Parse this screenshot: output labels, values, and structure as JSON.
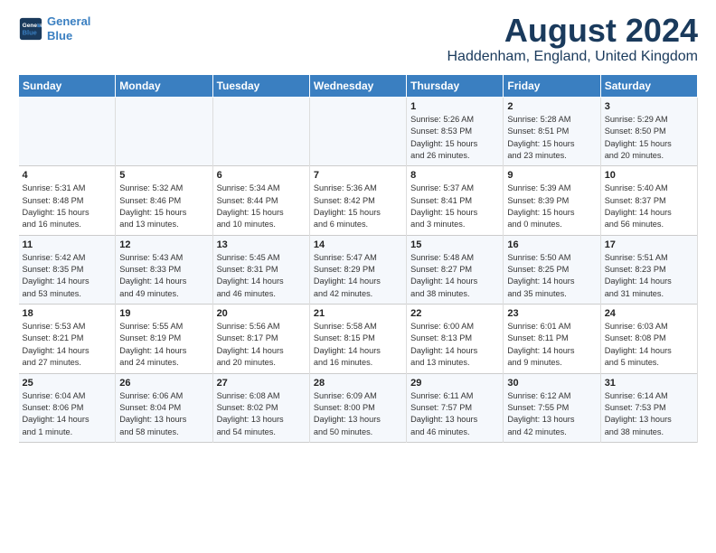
{
  "header": {
    "logo_line1": "General",
    "logo_line2": "Blue",
    "month_title": "August 2024",
    "location": "Haddenham, England, United Kingdom"
  },
  "weekdays": [
    "Sunday",
    "Monday",
    "Tuesday",
    "Wednesday",
    "Thursday",
    "Friday",
    "Saturday"
  ],
  "weeks": [
    [
      {
        "day": "",
        "info": ""
      },
      {
        "day": "",
        "info": ""
      },
      {
        "day": "",
        "info": ""
      },
      {
        "day": "",
        "info": ""
      },
      {
        "day": "1",
        "info": "Sunrise: 5:26 AM\nSunset: 8:53 PM\nDaylight: 15 hours\nand 26 minutes."
      },
      {
        "day": "2",
        "info": "Sunrise: 5:28 AM\nSunset: 8:51 PM\nDaylight: 15 hours\nand 23 minutes."
      },
      {
        "day": "3",
        "info": "Sunrise: 5:29 AM\nSunset: 8:50 PM\nDaylight: 15 hours\nand 20 minutes."
      }
    ],
    [
      {
        "day": "4",
        "info": "Sunrise: 5:31 AM\nSunset: 8:48 PM\nDaylight: 15 hours\nand 16 minutes."
      },
      {
        "day": "5",
        "info": "Sunrise: 5:32 AM\nSunset: 8:46 PM\nDaylight: 15 hours\nand 13 minutes."
      },
      {
        "day": "6",
        "info": "Sunrise: 5:34 AM\nSunset: 8:44 PM\nDaylight: 15 hours\nand 10 minutes."
      },
      {
        "day": "7",
        "info": "Sunrise: 5:36 AM\nSunset: 8:42 PM\nDaylight: 15 hours\nand 6 minutes."
      },
      {
        "day": "8",
        "info": "Sunrise: 5:37 AM\nSunset: 8:41 PM\nDaylight: 15 hours\nand 3 minutes."
      },
      {
        "day": "9",
        "info": "Sunrise: 5:39 AM\nSunset: 8:39 PM\nDaylight: 15 hours\nand 0 minutes."
      },
      {
        "day": "10",
        "info": "Sunrise: 5:40 AM\nSunset: 8:37 PM\nDaylight: 14 hours\nand 56 minutes."
      }
    ],
    [
      {
        "day": "11",
        "info": "Sunrise: 5:42 AM\nSunset: 8:35 PM\nDaylight: 14 hours\nand 53 minutes."
      },
      {
        "day": "12",
        "info": "Sunrise: 5:43 AM\nSunset: 8:33 PM\nDaylight: 14 hours\nand 49 minutes."
      },
      {
        "day": "13",
        "info": "Sunrise: 5:45 AM\nSunset: 8:31 PM\nDaylight: 14 hours\nand 46 minutes."
      },
      {
        "day": "14",
        "info": "Sunrise: 5:47 AM\nSunset: 8:29 PM\nDaylight: 14 hours\nand 42 minutes."
      },
      {
        "day": "15",
        "info": "Sunrise: 5:48 AM\nSunset: 8:27 PM\nDaylight: 14 hours\nand 38 minutes."
      },
      {
        "day": "16",
        "info": "Sunrise: 5:50 AM\nSunset: 8:25 PM\nDaylight: 14 hours\nand 35 minutes."
      },
      {
        "day": "17",
        "info": "Sunrise: 5:51 AM\nSunset: 8:23 PM\nDaylight: 14 hours\nand 31 minutes."
      }
    ],
    [
      {
        "day": "18",
        "info": "Sunrise: 5:53 AM\nSunset: 8:21 PM\nDaylight: 14 hours\nand 27 minutes."
      },
      {
        "day": "19",
        "info": "Sunrise: 5:55 AM\nSunset: 8:19 PM\nDaylight: 14 hours\nand 24 minutes."
      },
      {
        "day": "20",
        "info": "Sunrise: 5:56 AM\nSunset: 8:17 PM\nDaylight: 14 hours\nand 20 minutes."
      },
      {
        "day": "21",
        "info": "Sunrise: 5:58 AM\nSunset: 8:15 PM\nDaylight: 14 hours\nand 16 minutes."
      },
      {
        "day": "22",
        "info": "Sunrise: 6:00 AM\nSunset: 8:13 PM\nDaylight: 14 hours\nand 13 minutes."
      },
      {
        "day": "23",
        "info": "Sunrise: 6:01 AM\nSunset: 8:11 PM\nDaylight: 14 hours\nand 9 minutes."
      },
      {
        "day": "24",
        "info": "Sunrise: 6:03 AM\nSunset: 8:08 PM\nDaylight: 14 hours\nand 5 minutes."
      }
    ],
    [
      {
        "day": "25",
        "info": "Sunrise: 6:04 AM\nSunset: 8:06 PM\nDaylight: 14 hours\nand 1 minute."
      },
      {
        "day": "26",
        "info": "Sunrise: 6:06 AM\nSunset: 8:04 PM\nDaylight: 13 hours\nand 58 minutes."
      },
      {
        "day": "27",
        "info": "Sunrise: 6:08 AM\nSunset: 8:02 PM\nDaylight: 13 hours\nand 54 minutes."
      },
      {
        "day": "28",
        "info": "Sunrise: 6:09 AM\nSunset: 8:00 PM\nDaylight: 13 hours\nand 50 minutes."
      },
      {
        "day": "29",
        "info": "Sunrise: 6:11 AM\nSunset: 7:57 PM\nDaylight: 13 hours\nand 46 minutes."
      },
      {
        "day": "30",
        "info": "Sunrise: 6:12 AM\nSunset: 7:55 PM\nDaylight: 13 hours\nand 42 minutes."
      },
      {
        "day": "31",
        "info": "Sunrise: 6:14 AM\nSunset: 7:53 PM\nDaylight: 13 hours\nand 38 minutes."
      }
    ]
  ]
}
